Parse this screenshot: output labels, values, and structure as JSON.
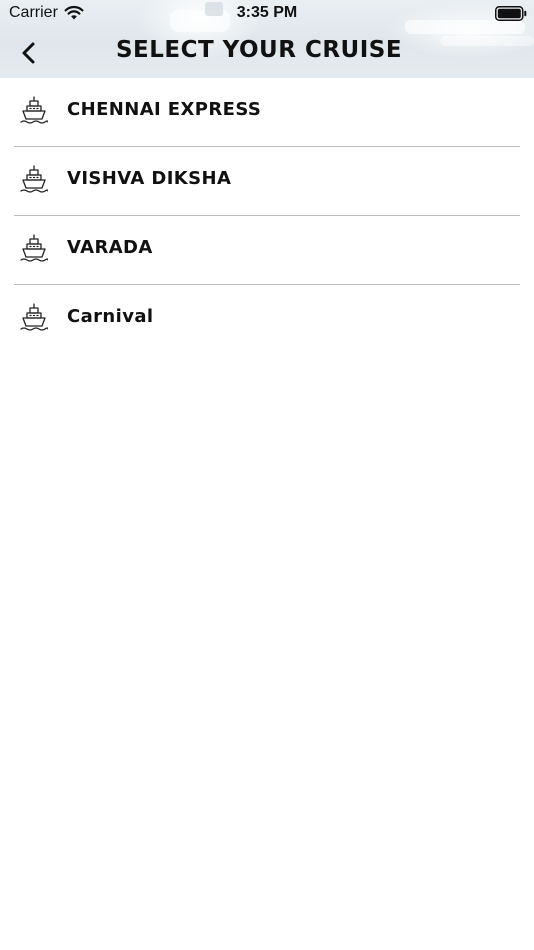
{
  "status_bar": {
    "carrier": "Carrier",
    "time": "3:35 PM"
  },
  "header": {
    "title": "SELECT YOUR CRUISE",
    "back_icon": "chevron-left-icon"
  },
  "cruises": {
    "icon": "ship-icon",
    "items": [
      {
        "label": "CHENNAI EXPRESS"
      },
      {
        "label": "VISHVA DIKSHA"
      },
      {
        "label": "VARADA"
      },
      {
        "label": "Carnival"
      }
    ]
  },
  "colors": {
    "divider": "#bdbdbd",
    "text": "#111111",
    "background": "#ffffff"
  }
}
